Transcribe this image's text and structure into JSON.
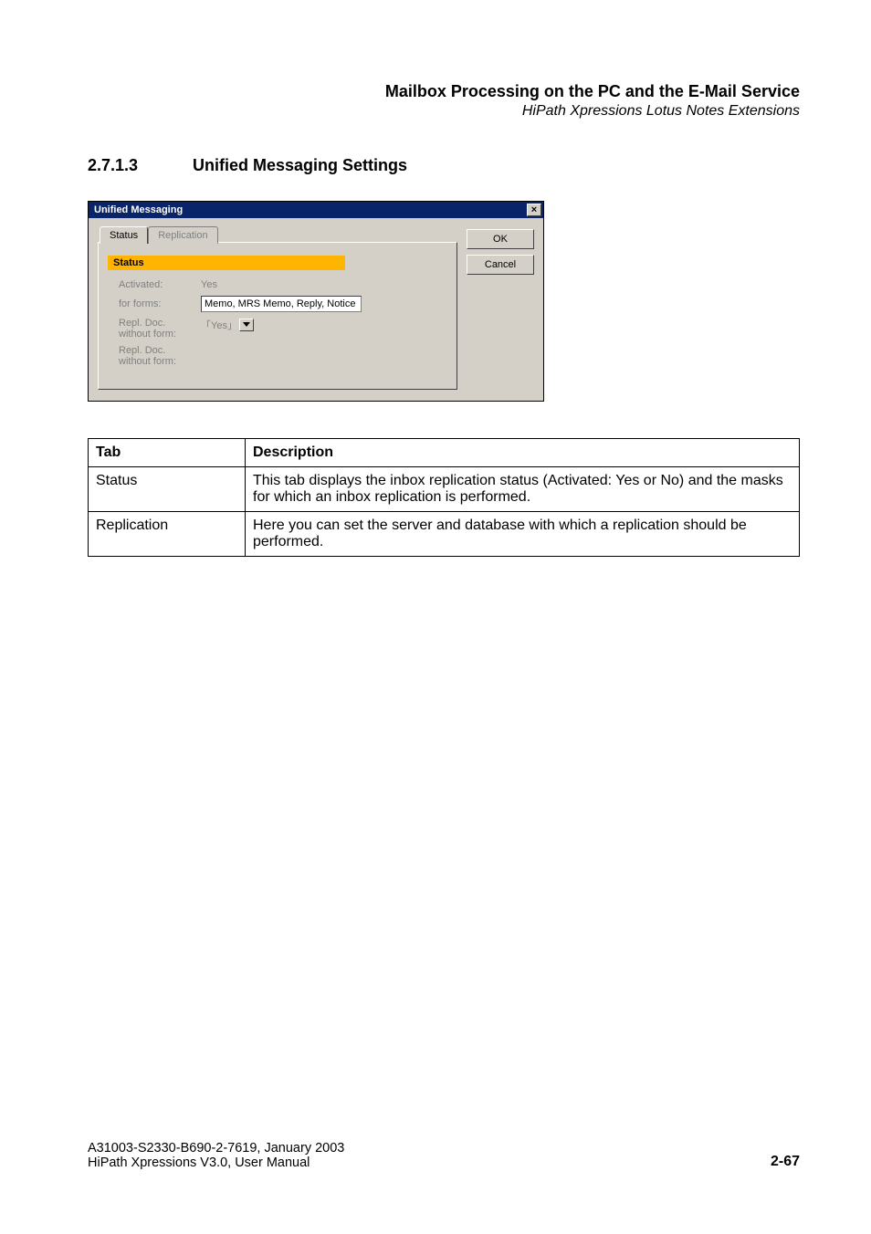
{
  "header": {
    "title": "Mailbox Processing on the PC and the E-Mail Service",
    "subtitle": "HiPath Xpressions Lotus Notes Extensions"
  },
  "section": {
    "number": "2.7.1.3",
    "title": "Unified Messaging Settings"
  },
  "dialog": {
    "title": "Unified Messaging",
    "buttons": {
      "ok": "OK",
      "cancel": "Cancel"
    },
    "tabs": {
      "status": "Status",
      "replication": "Replication"
    },
    "status_band": "Status",
    "rows": {
      "activated": {
        "label": "Activated:",
        "value": "Yes"
      },
      "for_forms": {
        "label": "for forms:",
        "value": "Memo, MRS Memo, Reply, Notice"
      },
      "repl_doc_1": {
        "label_line1": "Repl. Doc.",
        "label_line2": "without form:",
        "value": "Yes"
      },
      "repl_doc_2": {
        "label_line1": "Repl. Doc.",
        "label_line2": "without form:"
      }
    }
  },
  "table": {
    "headers": {
      "tab": "Tab",
      "description": "Description"
    },
    "rows": [
      {
        "tab": "Status",
        "description": "This tab displays the inbox replication status (Activated: Yes or No) and the masks for which an inbox replication is performed."
      },
      {
        "tab": "Replication",
        "description": "Here you can set the server and database with which a replication should be performed."
      }
    ]
  },
  "footer": {
    "line1": "A31003-S2330-B690-2-7619, January 2003",
    "line2": "HiPath Xpressions V3.0, User Manual",
    "page": "2-67"
  }
}
